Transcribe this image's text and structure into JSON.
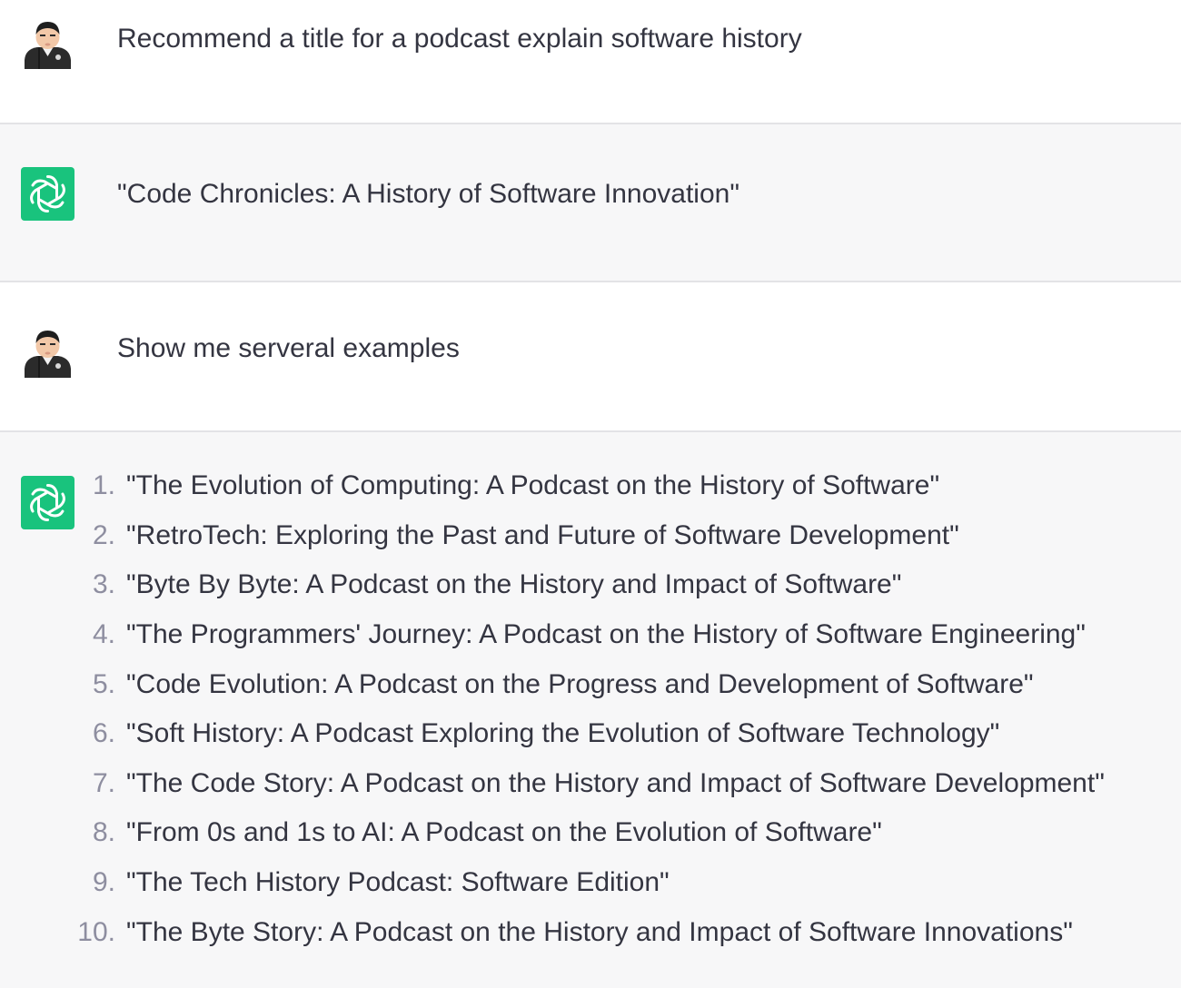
{
  "conversation": {
    "turns": [
      {
        "role": "user",
        "avatar_icon": "user-avatar-icon",
        "text": "Recommend a title for a podcast explain software history"
      },
      {
        "role": "assistant",
        "avatar_icon": "chatgpt-logo-icon",
        "text": "\"Code Chronicles: A History of Software Innovation\""
      },
      {
        "role": "user",
        "avatar_icon": "user-avatar-icon",
        "text": "Show me serveral examples"
      },
      {
        "role": "assistant",
        "avatar_icon": "chatgpt-logo-icon",
        "list": [
          {
            "num": "1.",
            "text": "\"The Evolution of Computing: A Podcast on the History of Software\""
          },
          {
            "num": "2.",
            "text": "\"RetroTech: Exploring the Past and Future of Software Development\""
          },
          {
            "num": "3.",
            "text": "\"Byte By Byte: A Podcast on the History and Impact of Software\""
          },
          {
            "num": "4.",
            "text": "\"The Programmers' Journey: A Podcast on the History of Software Engineering\""
          },
          {
            "num": "5.",
            "text": "\"Code Evolution: A Podcast on the Progress and Development of Software\""
          },
          {
            "num": "6.",
            "text": "\"Soft History: A Podcast Exploring the Evolution of Software Technology\""
          },
          {
            "num": "7.",
            "text": "\"The Code Story: A Podcast on the History and Impact of Software Development\""
          },
          {
            "num": "8.",
            "text": "\"From 0s and 1s to AI: A Podcast on the Evolution of Software\""
          },
          {
            "num": "9.",
            "text": "\"The Tech History Podcast: Software Edition\""
          },
          {
            "num": "10.",
            "text": "\"The Byte Story: A Podcast on the History and Impact of Software Innovations\""
          }
        ]
      }
    ]
  },
  "colors": {
    "assistant_bg": "#f7f7f8",
    "user_bg": "#ffffff",
    "brand_green": "#19c37d",
    "text": "#343541",
    "list_number": "#8e8ea0",
    "divider": "#e3e3e6"
  }
}
